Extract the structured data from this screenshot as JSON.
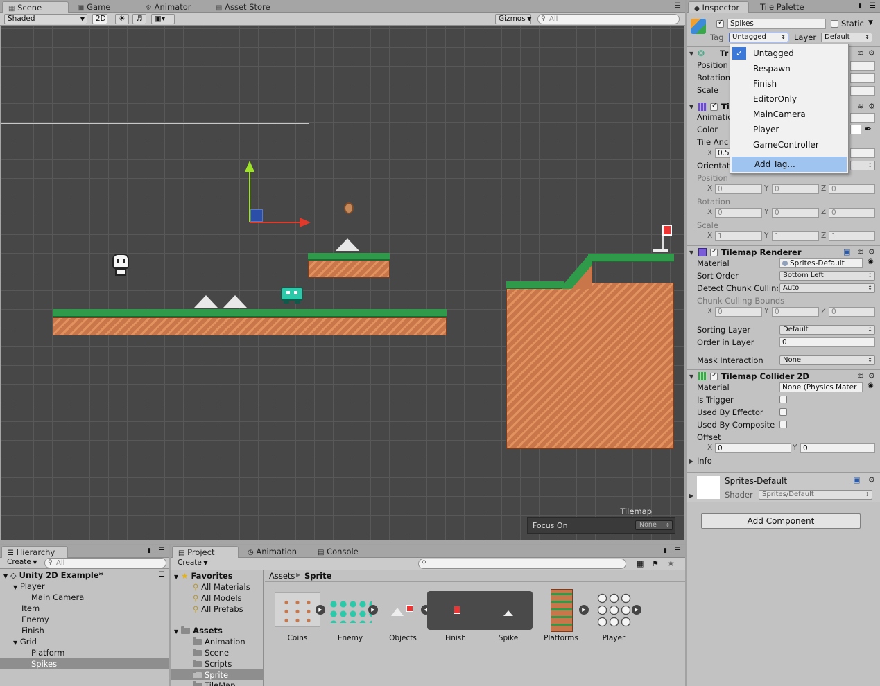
{
  "scene": {
    "tabs": [
      {
        "label": "Scene",
        "icon": "grid-icon"
      },
      {
        "label": "Game",
        "icon": "gamepad-icon"
      },
      {
        "label": "Animator",
        "icon": "animator-icon"
      },
      {
        "label": "Asset Store",
        "icon": "store-icon"
      }
    ],
    "toolbar": {
      "shading": "Shaded",
      "mode_2d": "2D",
      "gizmos": "Gizmos",
      "search_placeholder": "All"
    },
    "overlay": {
      "title": "Tilemap",
      "focus_label": "Focus On",
      "focus_value": "None"
    },
    "colors": {
      "background": "#474747",
      "grid": "#5a5a5a",
      "grass": "#2e9a4a",
      "dirt": "#c8764a"
    }
  },
  "inspector": {
    "tabs": [
      {
        "label": "Inspector",
        "icon": "info-icon"
      },
      {
        "label": "Tile Palette"
      }
    ],
    "object": {
      "name": "Spikes",
      "static_label": "Static",
      "tag_label": "Tag",
      "tag_value": "Untagged",
      "layer_label": "Layer",
      "layer_value": "Default"
    },
    "transform": {
      "title": "Tr",
      "rows": [
        "Position",
        "Rotation",
        "Scale"
      ]
    },
    "tilemap": {
      "title": "Ti",
      "rows": {
        "animation": "Animatio",
        "color": "Color",
        "tile_anchor": "Tile Anc",
        "anchor_x": "0.5",
        "orientation": "Orientat"
      },
      "offset_labels": [
        "Position",
        "Rotation",
        "Scale"
      ],
      "position": {
        "x": "0",
        "y": "0",
        "z": "0"
      },
      "rotation": {
        "x": "0",
        "y": "0",
        "z": "0"
      },
      "scale": {
        "x": "1",
        "y": "1",
        "z": "1"
      }
    },
    "renderer": {
      "title": "Tilemap Renderer",
      "material_label": "Material",
      "material_value": "Sprites-Default",
      "sort_order_label": "Sort Order",
      "sort_order_value": "Bottom Left",
      "detect_label": "Detect Chunk Cullinc",
      "detect_value": "Auto",
      "bounds_label": "Chunk Culling Bounds",
      "bounds": {
        "x": "0",
        "y": "0",
        "z": "0"
      },
      "sorting_layer_label": "Sorting Layer",
      "sorting_layer_value": "Default",
      "order_label": "Order in Layer",
      "order_value": "0",
      "mask_label": "Mask Interaction",
      "mask_value": "None"
    },
    "collider": {
      "title": "Tilemap Collider 2D",
      "material_label": "Material",
      "material_value": "None (Physics Mater",
      "trigger_label": "Is Trigger",
      "effector_label": "Used By Effector",
      "composite_label": "Used By Composite",
      "offset_label": "Offset",
      "offset": {
        "x": "0",
        "y": "0"
      },
      "info_label": "Info"
    },
    "material_preview": {
      "name": "Sprites-Default",
      "shader_label": "Shader",
      "shader_value": "Sprites/Default"
    },
    "add_component": "Add Component"
  },
  "tag_menu": {
    "items": [
      "Untagged",
      "Respawn",
      "Finish",
      "EditorOnly",
      "MainCamera",
      "Player",
      "GameController"
    ],
    "selected": "Untagged",
    "add_tag": "Add Tag..."
  },
  "hierarchy": {
    "tab": "Hierarchy",
    "create": "Create",
    "search_placeholder": "All",
    "scene_name": "Unity 2D Example*",
    "items": [
      {
        "label": "Player",
        "level": 1,
        "expanded": true
      },
      {
        "label": "Main Camera",
        "level": 2
      },
      {
        "label": "Item",
        "level": 1
      },
      {
        "label": "Enemy",
        "level": 1
      },
      {
        "label": "Finish",
        "level": 1
      },
      {
        "label": "Grid",
        "level": 1,
        "expanded": true
      },
      {
        "label": "Platform",
        "level": 2
      },
      {
        "label": "Spikes",
        "level": 2,
        "selected": true
      }
    ]
  },
  "project": {
    "tabs": [
      "Project",
      "Animation",
      "Console"
    ],
    "create": "Create",
    "favorites_label": "Favorites",
    "favorites": [
      "All Materials",
      "All Models",
      "All Prefabs"
    ],
    "assets_label": "Assets",
    "folders": [
      "Animation",
      "Scene",
      "Scripts",
      "Sprite",
      "TileMap"
    ],
    "selected_folder": "Sprite",
    "breadcrumb": [
      "Assets",
      "Sprite"
    ],
    "assets": [
      "Coins",
      "Enemy",
      "Objects",
      "Finish",
      "Spike",
      "Platforms",
      "Player"
    ]
  }
}
